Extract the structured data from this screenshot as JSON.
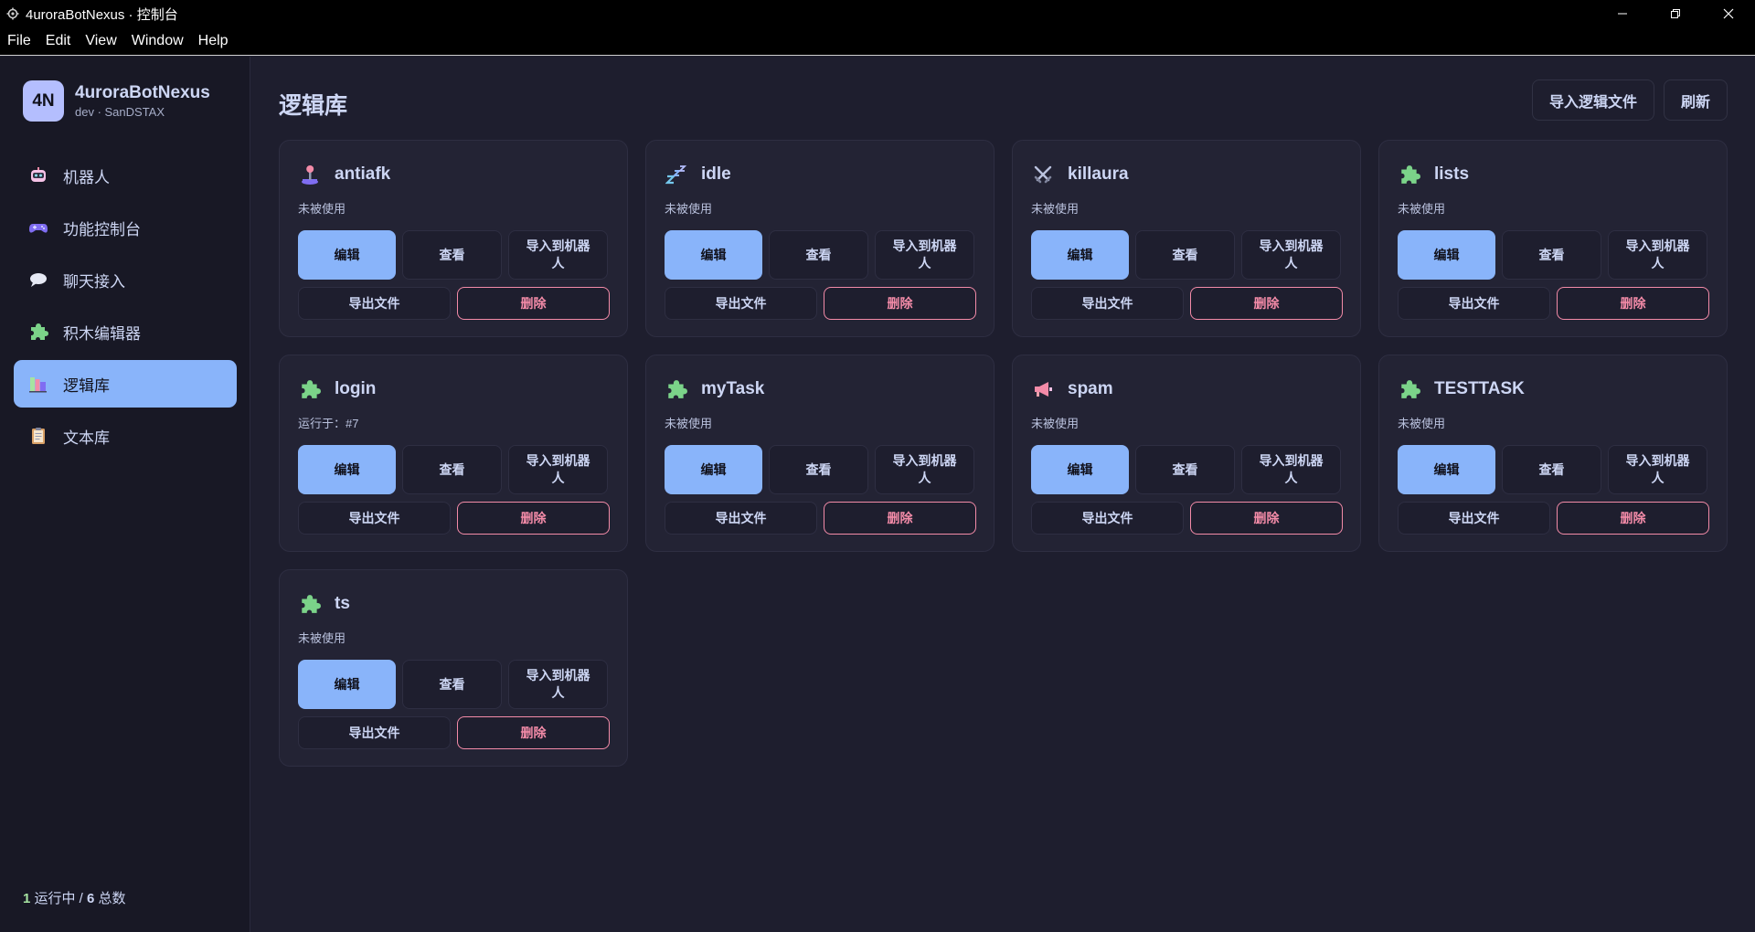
{
  "window": {
    "title": "4uroraBotNexus · 控制台",
    "icon": "gear-icon"
  },
  "menu": [
    "File",
    "Edit",
    "View",
    "Window",
    "Help"
  ],
  "brand": {
    "initials": "4N",
    "name": "4uroraBotNexus",
    "subtitle": "dev · SanDSTAX"
  },
  "nav": [
    {
      "label": "机器人",
      "icon": "robot-icon",
      "active": false
    },
    {
      "label": "功能控制台",
      "icon": "gamepad-icon",
      "active": false
    },
    {
      "label": "聊天接入",
      "icon": "chat-bubble-icon",
      "active": false
    },
    {
      "label": "积木编辑器",
      "icon": "puzzle-icon",
      "active": false
    },
    {
      "label": "逻辑库",
      "icon": "books-icon",
      "active": true
    },
    {
      "label": "文本库",
      "icon": "clipboard-icon",
      "active": false
    }
  ],
  "footer": {
    "running_count": "1",
    "running_label": "运行中 /",
    "total_count": "6",
    "total_label": "总数"
  },
  "main": {
    "title": "逻辑库",
    "import_button": "导入逻辑文件",
    "refresh_button": "刷新"
  },
  "buttons": {
    "edit": "编辑",
    "view": "查看",
    "import_to_bot": "导入到机器人",
    "export": "导出文件",
    "delete": "删除"
  },
  "logics": [
    {
      "name": "antiafk",
      "status": "未被使用",
      "icon": "joystick-icon"
    },
    {
      "name": "idle",
      "status": "未被使用",
      "icon": "sleep-icon"
    },
    {
      "name": "killaura",
      "status": "未被使用",
      "icon": "crossed-swords-icon"
    },
    {
      "name": "lists",
      "status": "未被使用",
      "icon": "puzzle-icon"
    },
    {
      "name": "login",
      "status": "运行于：#7",
      "icon": "puzzle-icon"
    },
    {
      "name": "myTask",
      "status": "未被使用",
      "icon": "puzzle-icon"
    },
    {
      "name": "spam",
      "status": "未被使用",
      "icon": "megaphone-icon"
    },
    {
      "name": "TESTTASK",
      "status": "未被使用",
      "icon": "puzzle-icon"
    },
    {
      "name": "ts",
      "status": "未被使用",
      "icon": "puzzle-icon"
    }
  ],
  "colors": {
    "accent": "#89b4fa",
    "danger": "#f38ba8",
    "success": "#a6e3a1",
    "background": "#1e1e2e",
    "sidebar": "#181825"
  }
}
